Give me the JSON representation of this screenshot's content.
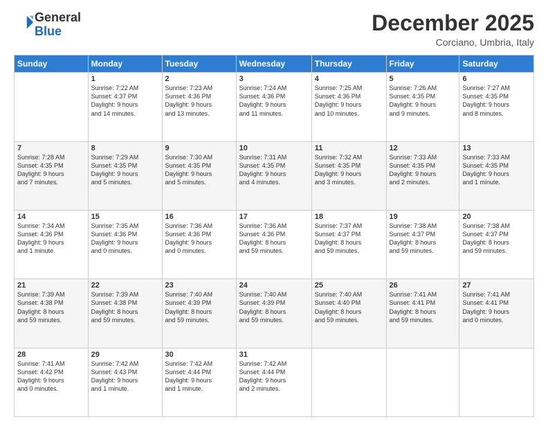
{
  "header": {
    "logo_line1": "General",
    "logo_line2": "Blue",
    "month": "December 2025",
    "location": "Corciano, Umbria, Italy"
  },
  "weekdays": [
    "Sunday",
    "Monday",
    "Tuesday",
    "Wednesday",
    "Thursday",
    "Friday",
    "Saturday"
  ],
  "weeks": [
    [
      {
        "day": "",
        "info": ""
      },
      {
        "day": "1",
        "info": "Sunrise: 7:22 AM\nSunset: 4:37 PM\nDaylight: 9 hours\nand 14 minutes."
      },
      {
        "day": "2",
        "info": "Sunrise: 7:23 AM\nSunset: 4:36 PM\nDaylight: 9 hours\nand 13 minutes."
      },
      {
        "day": "3",
        "info": "Sunrise: 7:24 AM\nSunset: 4:36 PM\nDaylight: 9 hours\nand 11 minutes."
      },
      {
        "day": "4",
        "info": "Sunrise: 7:25 AM\nSunset: 4:36 PM\nDaylight: 9 hours\nand 10 minutes."
      },
      {
        "day": "5",
        "info": "Sunrise: 7:26 AM\nSunset: 4:35 PM\nDaylight: 9 hours\nand 9 minutes."
      },
      {
        "day": "6",
        "info": "Sunrise: 7:27 AM\nSunset: 4:35 PM\nDaylight: 9 hours\nand 8 minutes."
      }
    ],
    [
      {
        "day": "7",
        "info": "Sunrise: 7:28 AM\nSunset: 4:35 PM\nDaylight: 9 hours\nand 7 minutes."
      },
      {
        "day": "8",
        "info": "Sunrise: 7:29 AM\nSunset: 4:35 PM\nDaylight: 9 hours\nand 5 minutes."
      },
      {
        "day": "9",
        "info": "Sunrise: 7:30 AM\nSunset: 4:35 PM\nDaylight: 9 hours\nand 5 minutes."
      },
      {
        "day": "10",
        "info": "Sunrise: 7:31 AM\nSunset: 4:35 PM\nDaylight: 9 hours\nand 4 minutes."
      },
      {
        "day": "11",
        "info": "Sunrise: 7:32 AM\nSunset: 4:35 PM\nDaylight: 9 hours\nand 3 minutes."
      },
      {
        "day": "12",
        "info": "Sunrise: 7:33 AM\nSunset: 4:35 PM\nDaylight: 9 hours\nand 2 minutes."
      },
      {
        "day": "13",
        "info": "Sunrise: 7:33 AM\nSunset: 4:35 PM\nDaylight: 9 hours\nand 1 minute."
      }
    ],
    [
      {
        "day": "14",
        "info": "Sunrise: 7:34 AM\nSunset: 4:36 PM\nDaylight: 9 hours\nand 1 minute."
      },
      {
        "day": "15",
        "info": "Sunrise: 7:35 AM\nSunset: 4:36 PM\nDaylight: 9 hours\nand 0 minutes."
      },
      {
        "day": "16",
        "info": "Sunrise: 7:36 AM\nSunset: 4:36 PM\nDaylight: 9 hours\nand 0 minutes."
      },
      {
        "day": "17",
        "info": "Sunrise: 7:36 AM\nSunset: 4:36 PM\nDaylight: 8 hours\nand 59 minutes."
      },
      {
        "day": "18",
        "info": "Sunrise: 7:37 AM\nSunset: 4:37 PM\nDaylight: 8 hours\nand 59 minutes."
      },
      {
        "day": "19",
        "info": "Sunrise: 7:38 AM\nSunset: 4:37 PM\nDaylight: 8 hours\nand 59 minutes."
      },
      {
        "day": "20",
        "info": "Sunrise: 7:38 AM\nSunset: 4:37 PM\nDaylight: 8 hours\nand 59 minutes."
      }
    ],
    [
      {
        "day": "21",
        "info": "Sunrise: 7:39 AM\nSunset: 4:38 PM\nDaylight: 8 hours\nand 59 minutes."
      },
      {
        "day": "22",
        "info": "Sunrise: 7:39 AM\nSunset: 4:38 PM\nDaylight: 8 hours\nand 59 minutes."
      },
      {
        "day": "23",
        "info": "Sunrise: 7:40 AM\nSunset: 4:39 PM\nDaylight: 8 hours\nand 59 minutes."
      },
      {
        "day": "24",
        "info": "Sunrise: 7:40 AM\nSunset: 4:39 PM\nDaylight: 8 hours\nand 59 minutes."
      },
      {
        "day": "25",
        "info": "Sunrise: 7:40 AM\nSunset: 4:40 PM\nDaylight: 8 hours\nand 59 minutes."
      },
      {
        "day": "26",
        "info": "Sunrise: 7:41 AM\nSunset: 4:41 PM\nDaylight: 8 hours\nand 59 minutes."
      },
      {
        "day": "27",
        "info": "Sunrise: 7:41 AM\nSunset: 4:41 PM\nDaylight: 9 hours\nand 0 minutes."
      }
    ],
    [
      {
        "day": "28",
        "info": "Sunrise: 7:41 AM\nSunset: 4:42 PM\nDaylight: 9 hours\nand 0 minutes."
      },
      {
        "day": "29",
        "info": "Sunrise: 7:42 AM\nSunset: 4:43 PM\nDaylight: 9 hours\nand 1 minute."
      },
      {
        "day": "30",
        "info": "Sunrise: 7:42 AM\nSunset: 4:44 PM\nDaylight: 9 hours\nand 1 minute."
      },
      {
        "day": "31",
        "info": "Sunrise: 7:42 AM\nSunset: 4:44 PM\nDaylight: 9 hours\nand 2 minutes."
      },
      {
        "day": "",
        "info": ""
      },
      {
        "day": "",
        "info": ""
      },
      {
        "day": "",
        "info": ""
      }
    ]
  ]
}
